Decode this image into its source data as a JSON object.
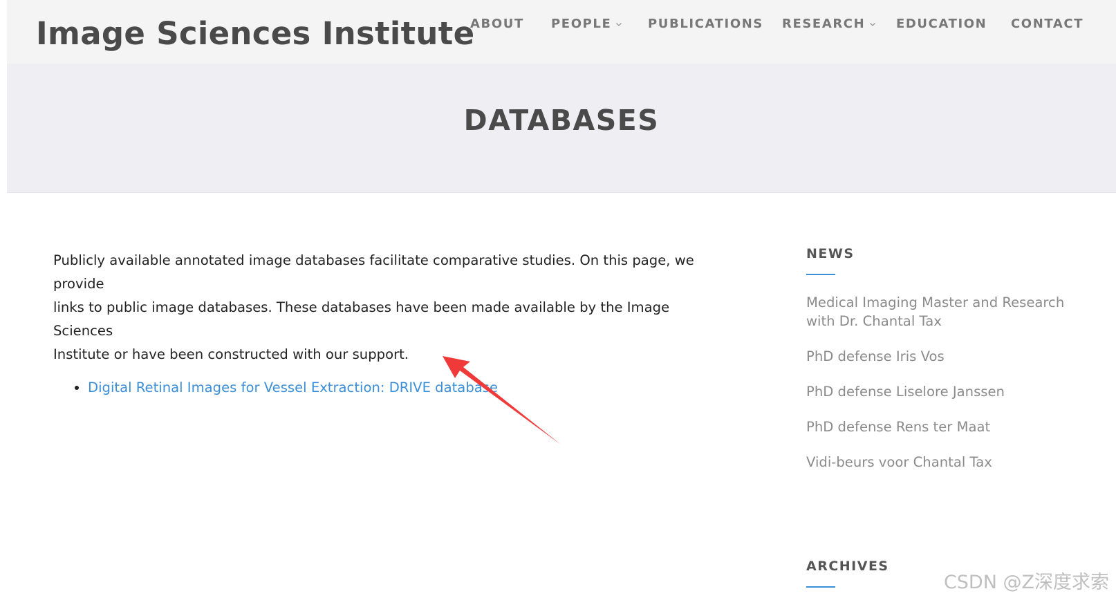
{
  "site": {
    "title": "Image Sciences Institute"
  },
  "nav": {
    "items": [
      {
        "label": "ABOUT"
      },
      {
        "label": "PEOPLE",
        "has_dropdown": true
      },
      {
        "label": "PUBLICATIONS"
      },
      {
        "label": "RESEARCH",
        "has_dropdown": true
      },
      {
        "label": "EDUCATION"
      },
      {
        "label": "CONTACT"
      }
    ]
  },
  "banner": {
    "heading": "DATABASES"
  },
  "content": {
    "intro_lines": [
      "Publicly available annotated image databases facilitate comparative studies. On this page, we provide",
      "links to public image databases. These databases have been made available by the Image Sciences",
      "Institute or have been constructed with our support."
    ],
    "databases": [
      {
        "label": "Digital Retinal Images for Vessel Extraction: DRIVE database"
      }
    ]
  },
  "sidebar": {
    "news_title": "NEWS",
    "news": [
      {
        "label": " Medical Imaging Master and Research with Dr. Chantal Tax"
      },
      {
        "label": " PhD defense Iris Vos"
      },
      {
        "label": " PhD defense Liselore Janssen"
      },
      {
        "label": " PhD defense Rens ter Maat"
      },
      {
        "label": " Vidi-beurs voor Chantal Tax"
      }
    ],
    "archives_title": "ARCHIVES"
  },
  "annotation": {
    "arrow_color": "#f03a3a"
  },
  "watermark": {
    "text": "CSDN @Z深度求索"
  },
  "colors": {
    "link": "#3b8fd8",
    "accent_underline": "#3b8fd8",
    "header_bg": "#f4f4f4",
    "banner_bg": "#efeff3"
  }
}
